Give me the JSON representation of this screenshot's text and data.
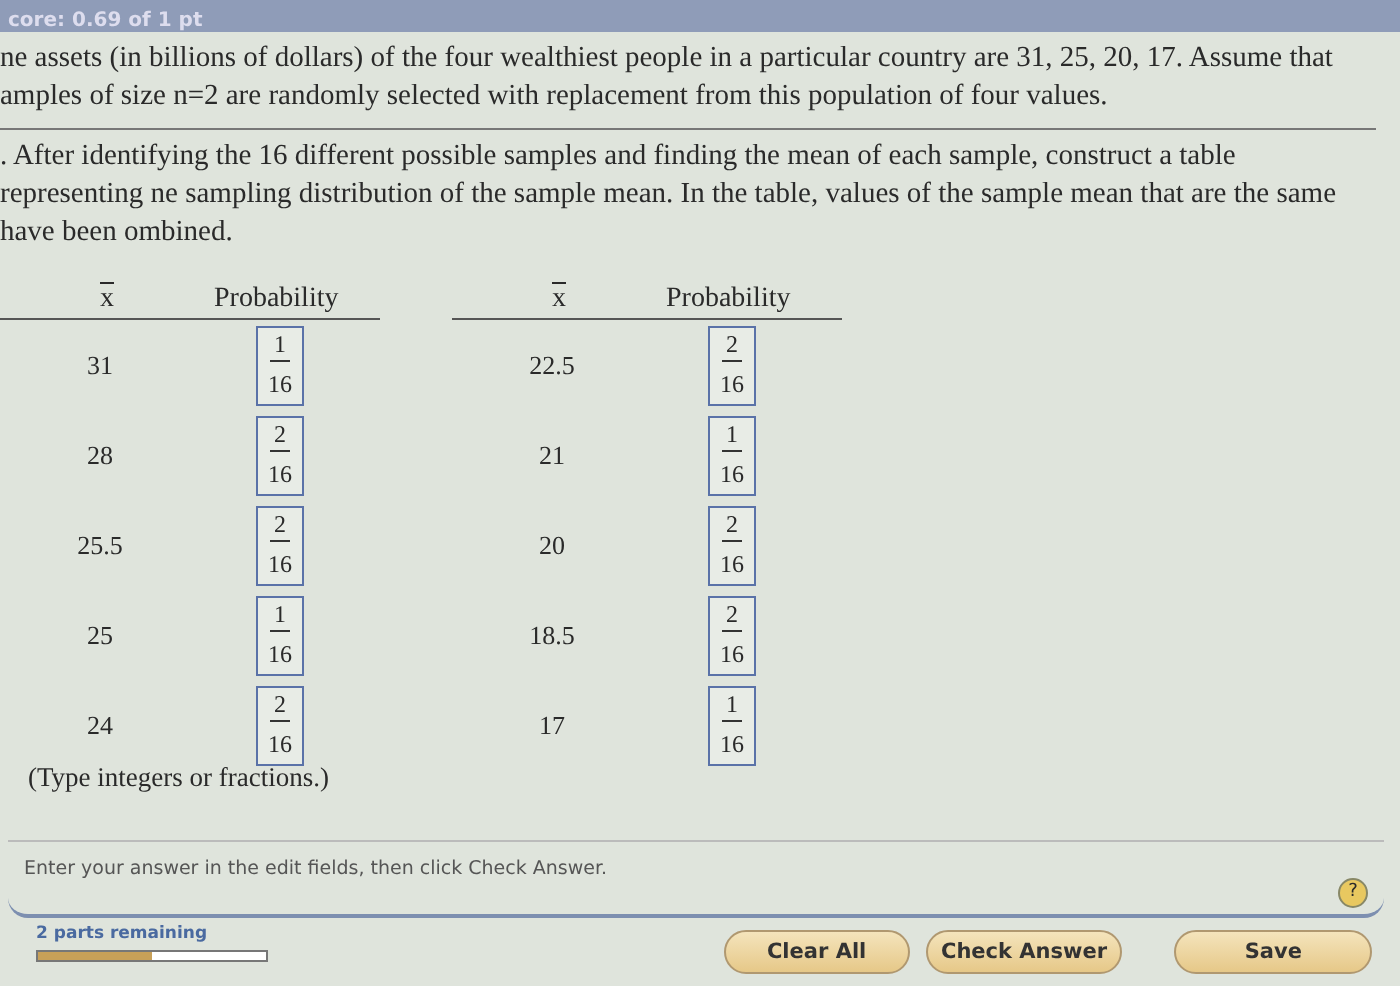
{
  "header": {
    "score": "core: 0.69 of 1 pt"
  },
  "problem": {
    "intro": "ne assets (in billions of dollars) of the four wealthiest people in a particular country are 31, 25, 20, 17. Assume that amples of size n=2 are randomly selected with replacement from this population of four values.",
    "question": ". After identifying the 16 different possible samples and finding the mean of each sample, construct a table representing ne sampling distribution of the sample mean. In the table, values of the sample mean that are the same have been ombined."
  },
  "tables": [
    {
      "columns": [
        "x",
        "Probability"
      ],
      "rows": [
        {
          "value": "31",
          "numerator": "1",
          "denominator": "16"
        },
        {
          "value": "28",
          "numerator": "2",
          "denominator": "16"
        },
        {
          "value": "25.5",
          "numerator": "2",
          "denominator": "16"
        },
        {
          "value": "25",
          "numerator": "1",
          "denominator": "16"
        },
        {
          "value": "24",
          "numerator": "2",
          "denominator": "16"
        }
      ]
    },
    {
      "columns": [
        "x",
        "Probability"
      ],
      "rows": [
        {
          "value": "22.5",
          "numerator": "2",
          "denominator": "16"
        },
        {
          "value": "21",
          "numerator": "1",
          "denominator": "16"
        },
        {
          "value": "20",
          "numerator": "2",
          "denominator": "16"
        },
        {
          "value": "18.5",
          "numerator": "2",
          "denominator": "16"
        },
        {
          "value": "17",
          "numerator": "1",
          "denominator": "16"
        }
      ]
    }
  ],
  "hint": "(Type integers or fractions.)",
  "instruction": "Enter your answer in the edit fields, then click Check Answer.",
  "help": "?",
  "progress": {
    "label": "2 parts remaining",
    "level": 0.5
  },
  "buttons": [
    "Clear All",
    "Check Answer",
    "Save"
  ]
}
